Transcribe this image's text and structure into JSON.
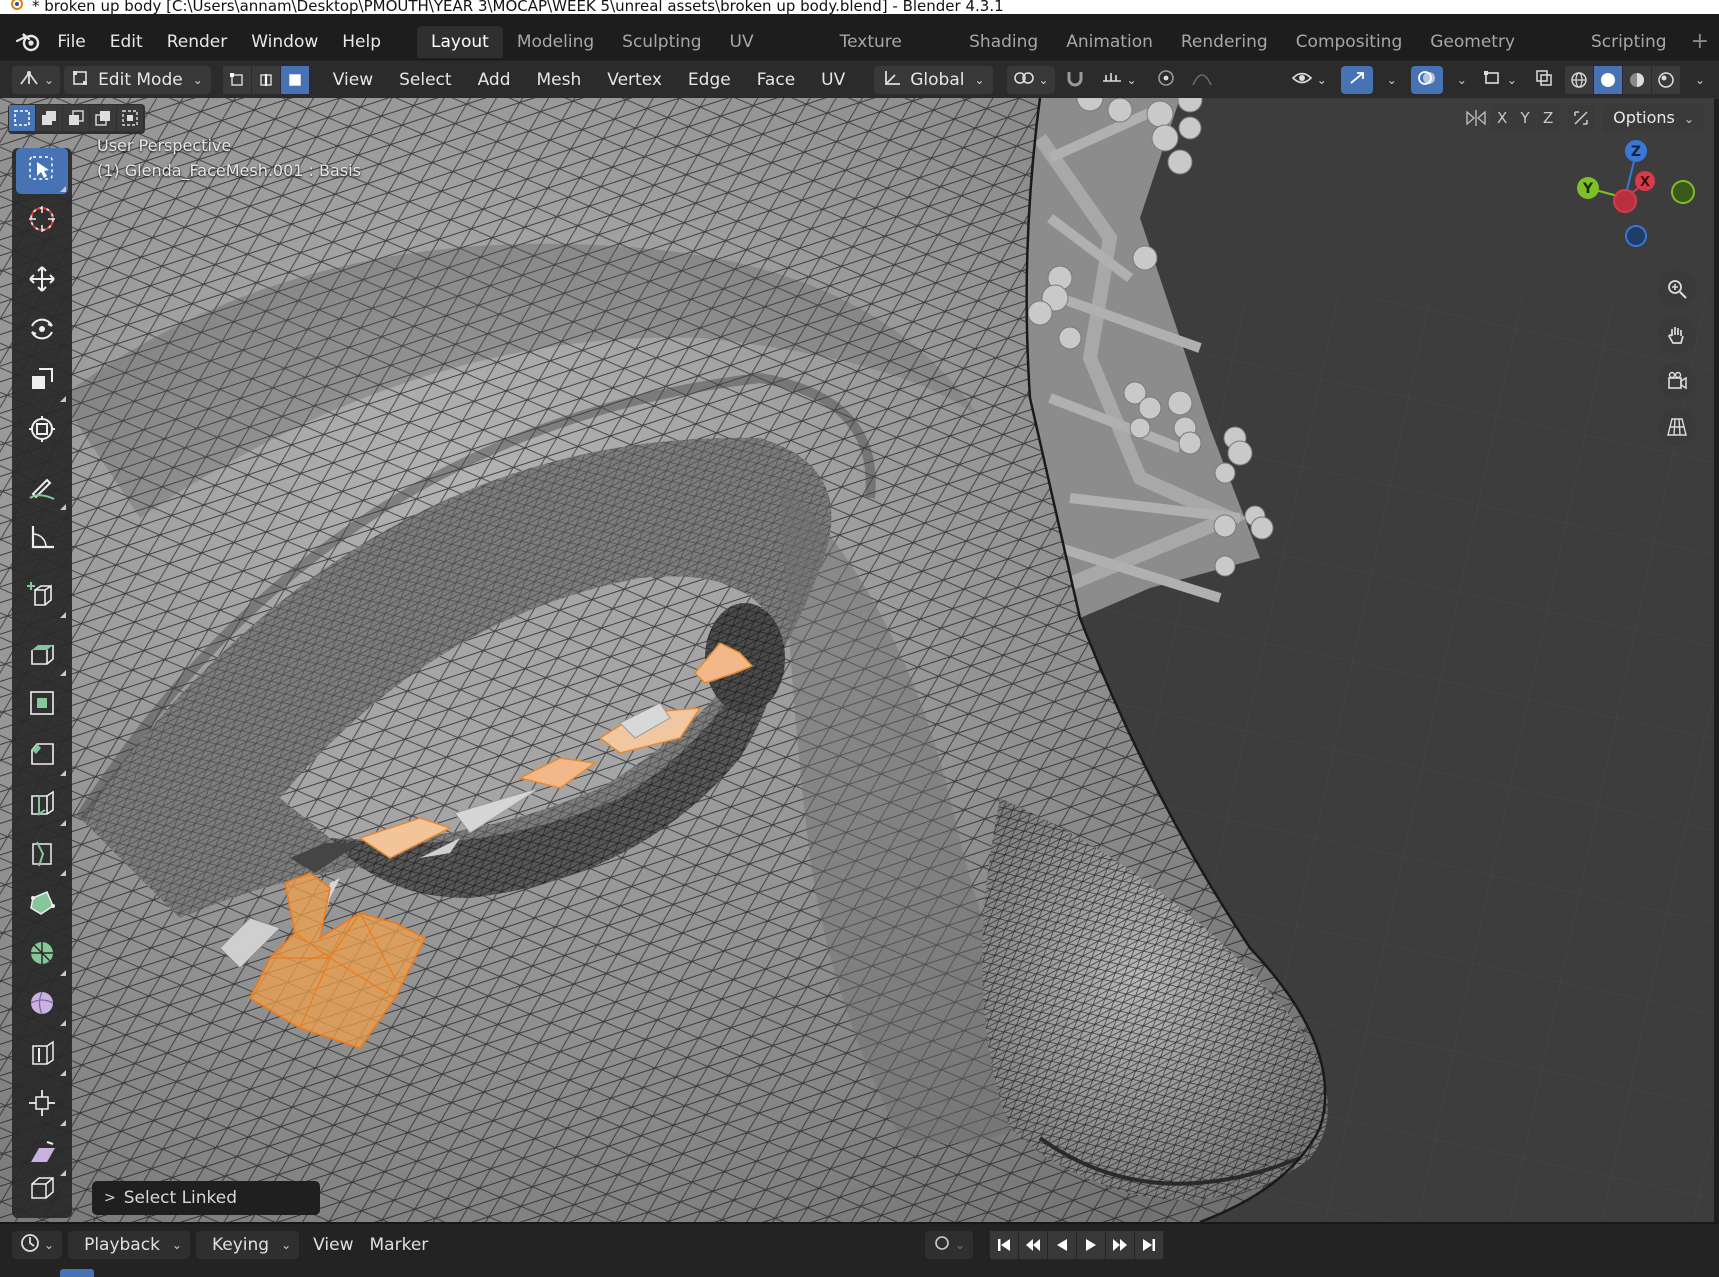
{
  "window": {
    "title": "* broken up body [C:\\Users\\annam\\Desktop\\PMOUTH\\YEAR 3\\MOCAP\\WEEK 5\\unreal assets\\broken up body.blend] - Blender 4.3.1"
  },
  "menu": {
    "items": [
      "File",
      "Edit",
      "Render",
      "Window",
      "Help"
    ]
  },
  "workspaces": {
    "tabs": [
      "Layout",
      "Modeling",
      "Sculpting",
      "UV Editing",
      "Texture Paint",
      "Shading",
      "Animation",
      "Rendering",
      "Compositing",
      "Geometry Nodes",
      "Scripting"
    ],
    "active": "Layout",
    "add_label": "+"
  },
  "viewport_header": {
    "mode": "Edit Mode",
    "menus": [
      "View",
      "Select",
      "Add",
      "Mesh",
      "Vertex",
      "Edge",
      "Face",
      "UV"
    ],
    "orientation": "Global"
  },
  "viewport_overlay": {
    "view_name": "User Perspective",
    "object_info": "(1) Glenda_FaceMesh.001 : Basis",
    "axes": [
      "X",
      "Y",
      "Z"
    ],
    "options_label": "Options",
    "gizmo": {
      "z": "Z",
      "y": "Y",
      "x": "X"
    }
  },
  "last_operator": {
    "label": "Select Linked",
    "chevron": ">"
  },
  "timeline": {
    "menus": [
      "Playback",
      "Keying",
      "View",
      "Marker"
    ]
  },
  "colors": {
    "accent": "#4772b3",
    "selection": "#f0a04b",
    "viewport_bg": "#3c3c3c",
    "mesh": "#8a8a8a"
  }
}
